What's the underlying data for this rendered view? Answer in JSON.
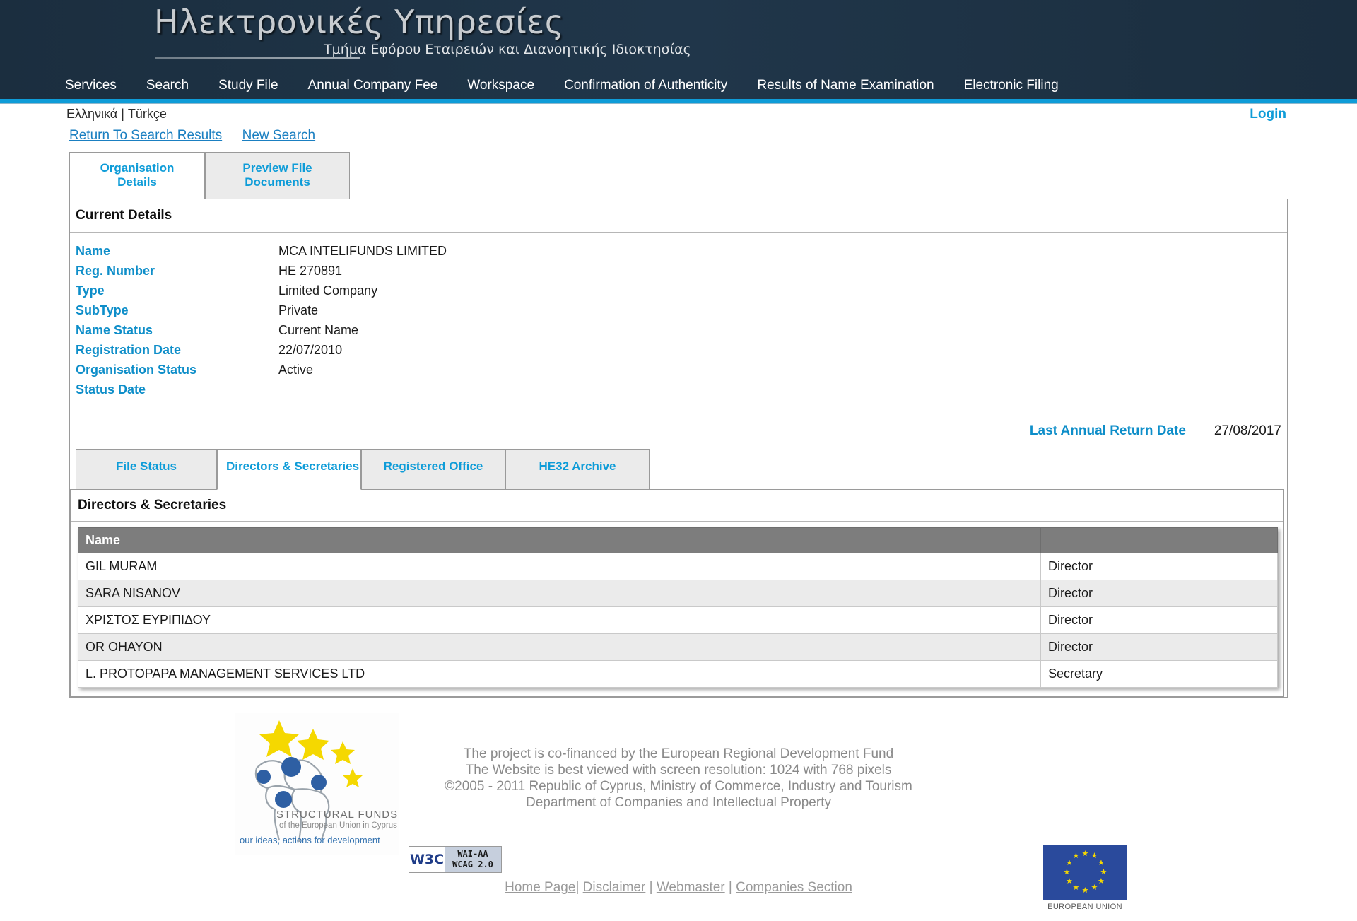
{
  "header": {
    "brand_title": "Ηλεκτρονικές Υπηρεσίες",
    "brand_subtitle": "Τμήμα Εφόρου Εταιρειών και Διανοητικής Ιδιοκτησίας",
    "nav": [
      {
        "label": "Services"
      },
      {
        "label": "Search"
      },
      {
        "label": "Study File"
      },
      {
        "label": "Annual Company Fee"
      },
      {
        "label": "Workspace"
      },
      {
        "label": "Confirmation of Authenticity"
      },
      {
        "label": "Results of Name Examination"
      },
      {
        "label": "Electronic Filing"
      }
    ],
    "languages": "Ελληνικά | Türkçe",
    "login_label": "Login",
    "accent_color": "#0e9cd8",
    "background_color": "#1d3042"
  },
  "actions": {
    "return_to_search": "Return To Search Results",
    "new_search": "New Search"
  },
  "tabs": [
    {
      "label": "Organisation Details",
      "active": true
    },
    {
      "label": "Preview File Documents",
      "active": false
    }
  ],
  "current_details": {
    "section_title": "Current Details",
    "rows": [
      {
        "label": "Name",
        "value": "MCA INTELIFUNDS LIMITED"
      },
      {
        "label": "Reg. Number",
        "value": "HE 270891"
      },
      {
        "label": "Type",
        "value": "Limited Company"
      },
      {
        "label": "SubType",
        "value": "Private"
      },
      {
        "label": "Name Status",
        "value": "Current Name"
      },
      {
        "label": "Registration Date",
        "value": "22/07/2010"
      },
      {
        "label": "Organisation Status",
        "value": "Active"
      },
      {
        "label": "Status Date",
        "value": ""
      }
    ],
    "last_annual_return_label": "Last Annual Return Date",
    "last_annual_return_value": "27/08/2017"
  },
  "subtabs": [
    {
      "label": "File Status",
      "active": false
    },
    {
      "label": "Directors & Secretaries",
      "active": true
    },
    {
      "label": "Registered Office",
      "active": false
    },
    {
      "label": "HE32 Archive",
      "active": false
    }
  ],
  "directors_panel": {
    "section_title": "Directors & Secretaries",
    "columns": [
      "Name",
      ""
    ],
    "rows": [
      {
        "name": "GIL MURAM",
        "role": "Director"
      },
      {
        "name": "SARA NISANOV",
        "role": "Director"
      },
      {
        "name": "ΧΡΙΣΤΟΣ ΕΥΡΙΠΙΔΟΥ",
        "role": "Director"
      },
      {
        "name": "OR OHAYON",
        "role": "Director"
      },
      {
        "name": "L. PROTOPAPA MANAGEMENT SERVICES LTD",
        "role": "Secretary"
      }
    ]
  },
  "footer": {
    "structural_funds": {
      "line1": "STRUCTURAL FUNDS",
      "line2": "of the European Union in Cyprus",
      "line3": "our ideas, actions for development"
    },
    "w3c_badge": {
      "left": "W3C",
      "line1": "WAI-AA",
      "line2": "WCAG 2.0"
    },
    "notes": [
      "The project is co-financed by the European Regional Development Fund",
      "The Website is best viewed with screen resolution: 1024 with 768 pixels",
      "©2005 - 2011 Republic of Cyprus, Ministry of Commerce, Industry and Tourism",
      "Department of Companies and Intellectual Property"
    ],
    "eu_caption": "EUROPEAN UNION",
    "links": [
      {
        "label": "Home Page"
      },
      {
        "label": "Disclaimer"
      },
      {
        "label": "Webmaster"
      },
      {
        "label": "Companies Section"
      }
    ]
  }
}
